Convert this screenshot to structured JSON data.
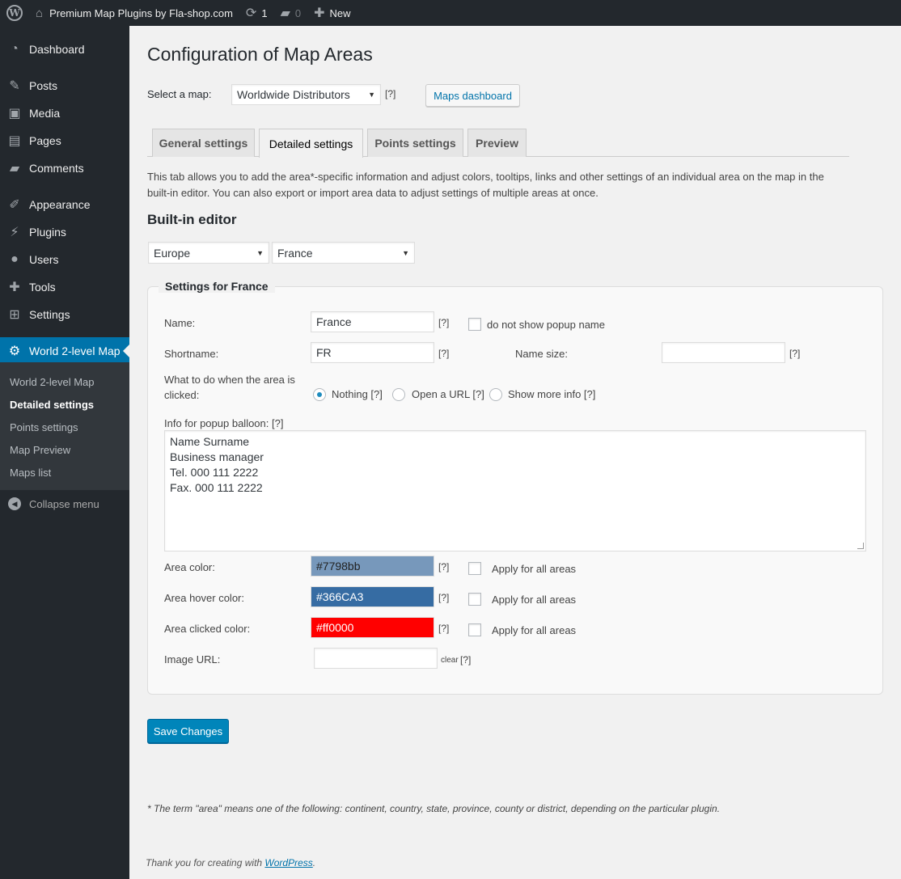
{
  "adminbar": {
    "site_name": "Premium Map Plugins by Fla-shop.com",
    "updates_count": "1",
    "comments_count": "0",
    "new_label": "New"
  },
  "sidebar": {
    "items": [
      {
        "label": "Dashboard",
        "icon": "dashboard-icon"
      },
      {
        "label": "Posts",
        "icon": "pin-icon"
      },
      {
        "label": "Media",
        "icon": "media-icon"
      },
      {
        "label": "Pages",
        "icon": "pages-icon"
      },
      {
        "label": "Comments",
        "icon": "comments-icon"
      },
      {
        "label": "Appearance",
        "icon": "brush-icon"
      },
      {
        "label": "Plugins",
        "icon": "plug-icon"
      },
      {
        "label": "Users",
        "icon": "user-icon"
      },
      {
        "label": "Tools",
        "icon": "wrench-icon"
      },
      {
        "label": "Settings",
        "icon": "sliders-icon"
      },
      {
        "label": "World 2-level Map",
        "icon": "gear-icon"
      }
    ],
    "submenu": [
      {
        "label": "World 2-level Map"
      },
      {
        "label": "Detailed settings"
      },
      {
        "label": "Points settings"
      },
      {
        "label": "Map Preview"
      },
      {
        "label": "Maps list"
      }
    ],
    "collapse_label": "Collapse menu"
  },
  "page": {
    "title": "Configuration of Map Areas",
    "select_map_label": "Select a map:",
    "selected_map": "Worldwide Distributors",
    "help": "[?]",
    "maps_dashboard_button": "Maps dashboard",
    "tabs": [
      {
        "label": "General settings"
      },
      {
        "label": "Detailed settings"
      },
      {
        "label": "Points settings"
      },
      {
        "label": "Preview"
      }
    ],
    "intro_line1": "This tab allows you to add the area*-specific information and adjust colors, tooltips, links and other settings of an individual area on the map in the",
    "intro_line2": "built-in editor. You can also export or import area data to adjust settings of multiple areas at once.",
    "builtin_editor_title": "Built-in editor",
    "region_select": "Europe",
    "country_select": "France"
  },
  "form": {
    "legend": "Settings for France",
    "name_label": "Name:",
    "name_value": "France",
    "hide_popup_label": "do not show popup name",
    "shortname_label": "Shortname:",
    "shortname_value": "FR",
    "name_size_label": "Name size:",
    "name_size_value": "",
    "click_label_line1": "What to do when the area is",
    "click_label_line2": "clicked:",
    "click_options": [
      {
        "label": "Nothing [?]",
        "checked": true
      },
      {
        "label": "Open a URL [?]",
        "checked": false
      },
      {
        "label": "Show more info [?]",
        "checked": false
      }
    ],
    "popup_info_label": "Info for popup balloon: [?]",
    "popup_info_lines": [
      "Name Surname",
      "Business manager",
      "Tel. 000 111 2222",
      "Fax. 000 111 2222"
    ],
    "area_color_label": "Area color:",
    "area_color_value": "#7798bb",
    "area_hover_color_label": "Area hover color:",
    "area_hover_color_value": "#366CA3",
    "area_clicked_color_label": "Area clicked color:",
    "area_clicked_color_value": "#ff0000",
    "apply_all_label": "Apply for all areas",
    "image_url_label": "Image URL:",
    "image_url_value": "",
    "clear_label": "clear",
    "save_button": "Save Changes"
  },
  "footnote": "* The term \"area\" means one of the following: continent, country, state, province, county or district, depending on the particular plugin.",
  "footer": {
    "prefix": "Thank you for creating with ",
    "link": "WordPress",
    "suffix": "."
  }
}
